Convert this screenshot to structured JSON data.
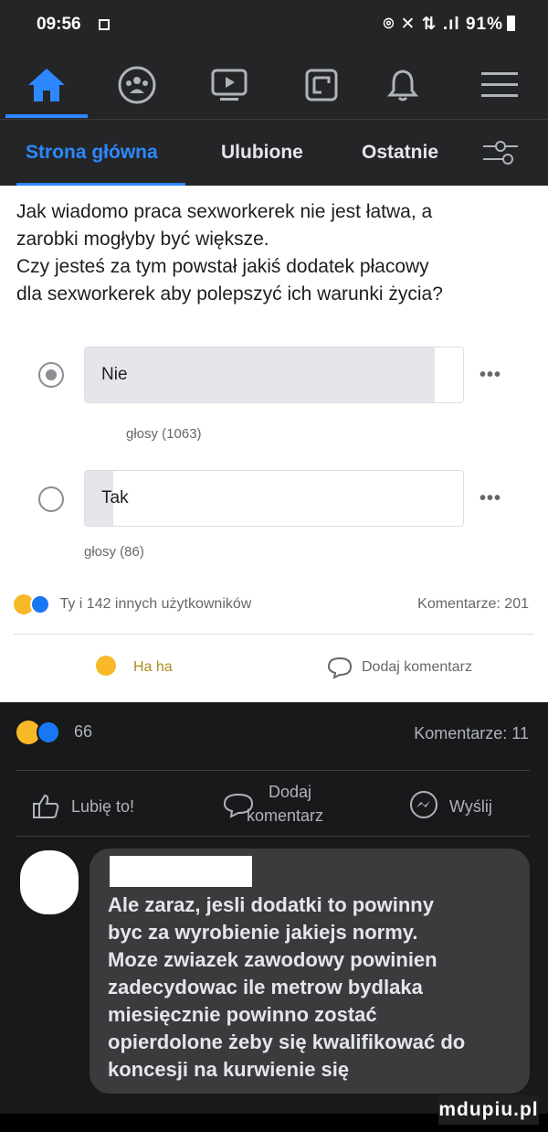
{
  "status_bar": {
    "time": "09:56",
    "battery": "91%",
    "right_icons": "⌾ ✕ ⇅ .ıl"
  },
  "nav": {
    "icons": [
      "home-icon",
      "groups-icon",
      "watch-icon",
      "pages-icon",
      "notifications-icon",
      "menu-icon"
    ],
    "active_color": "#2d88ff"
  },
  "tabs": {
    "items": [
      "Strona główna",
      "Ulubione",
      "Ostatnie"
    ],
    "active": "Strona główna"
  },
  "post": {
    "lines": [
      "Jak wiadomo praca sexworkerek nie jest łatwa, a",
      "zarobki mogłyby być większe.",
      "Czy jesteś za tym powstał jakiś dodatek płacowy",
      "dla sexworkerek aby polepszyć ich warunki życia?"
    ],
    "poll": [
      {
        "label": "Nie",
        "votes_text": "głosy (1063)",
        "share": 0.925,
        "selected": true
      },
      {
        "label": "Tak",
        "votes_text": "głosy (86)",
        "share": 0.075,
        "selected": false
      }
    ],
    "more_label": "•••",
    "reactions_text": "Ty i 142 innych użytkowników",
    "comments_text": "Komentarze: 201",
    "reaction_action": "Ha ha",
    "comment_action": "Dodaj komentarz"
  },
  "shared": {
    "reaction_count": "66",
    "comments_text": "Komentarze: 11",
    "like_label": "Lubię to!",
    "comment_label_1": "Dodaj",
    "comment_label_2": "komentarz",
    "share_label": "Wyślij"
  },
  "comment": {
    "lines": [
      "Ale zaraz, jesli dodatki to powinny",
      "byc za wyrobienie jakiejs normy.",
      "Moze zwiazek zawodowy powinien",
      "zadecydowac ile metrow bydlaka",
      "miesięcznie powinno zostać",
      "opierdolone żeby się kwalifikować do",
      "koncesji na kurwienie się"
    ]
  },
  "watermark": "mdupiu.pl"
}
